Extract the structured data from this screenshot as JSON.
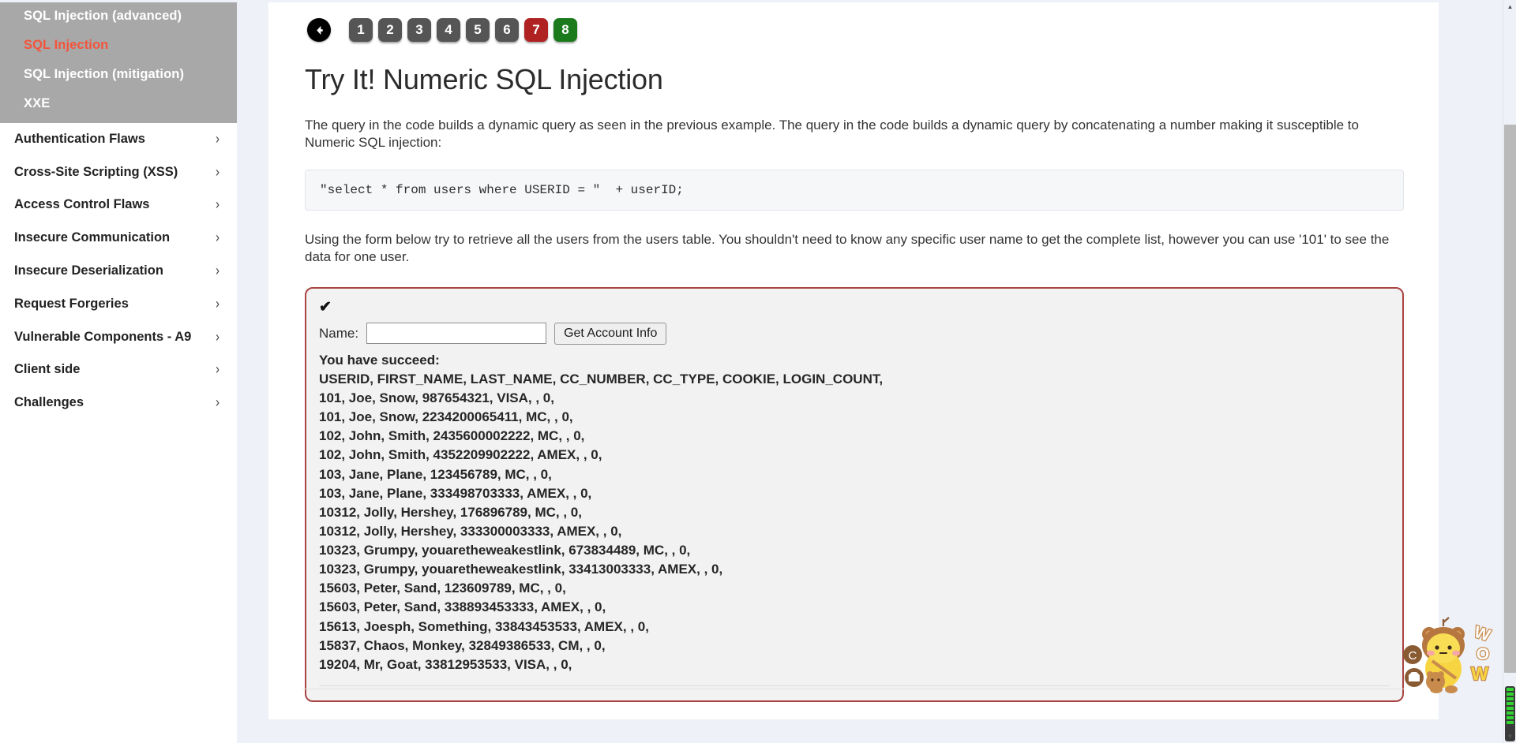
{
  "sidebar": {
    "subgroup": [
      {
        "label": "SQL Injection (advanced)",
        "active": false
      },
      {
        "label": "SQL Injection",
        "active": true
      },
      {
        "label": "SQL Injection (mitigation)",
        "active": false
      },
      {
        "label": "XXE",
        "active": false
      }
    ],
    "items": [
      {
        "label": "Authentication Flaws",
        "chevron": "›"
      },
      {
        "label": "Cross-Site Scripting (XSS)",
        "chevron": "›"
      },
      {
        "label": "Access Control Flaws",
        "chevron": "›"
      },
      {
        "label": "Insecure Communication",
        "chevron": "›"
      },
      {
        "label": "Insecure Deserialization",
        "chevron": "›"
      },
      {
        "label": "Request Forgeries",
        "chevron": "›"
      },
      {
        "label": "Vulnerable Components - A9",
        "chevron": "›"
      },
      {
        "label": "Client side",
        "chevron": "›"
      },
      {
        "label": "Challenges",
        "chevron": "›"
      }
    ]
  },
  "pager": {
    "back_icon": "←",
    "pages": [
      {
        "label": "1",
        "state": "normal"
      },
      {
        "label": "2",
        "state": "normal"
      },
      {
        "label": "3",
        "state": "normal"
      },
      {
        "label": "4",
        "state": "normal"
      },
      {
        "label": "5",
        "state": "normal"
      },
      {
        "label": "6",
        "state": "normal"
      },
      {
        "label": "7",
        "state": "current"
      },
      {
        "label": "8",
        "state": "done"
      }
    ],
    "colors": {
      "normal": "#555555",
      "current": "#b02121",
      "done": "#1b7a1b"
    }
  },
  "lesson": {
    "title": "Try It! Numeric SQL Injection",
    "intro": "The query in the code builds a dynamic query as seen in the previous example. The query in the code builds a dynamic query by concatenating a number making it susceptible to Numeric SQL injection:",
    "code": "\"select * from users where USERID = \"  + userID;",
    "instructions": "Using the form below try to retrieve all the users from the users table. You shouldn't need to know any specific user name to get the complete list, however you can use '101' to see the data for one user."
  },
  "form": {
    "status_icon": "✔",
    "name_label": "Name:",
    "name_value": "",
    "name_placeholder": "",
    "submit_label": "Get Account Info"
  },
  "result": {
    "status": "You have succeed:",
    "columns": "USERID, FIRST_NAME, LAST_NAME, CC_NUMBER, CC_TYPE, COOKIE, LOGIN_COUNT,",
    "rows": [
      "101, Joe, Snow, 987654321, VISA, , 0,",
      "101, Joe, Snow, 2234200065411, MC, , 0,",
      "102, John, Smith, 2435600002222, MC, , 0,",
      "102, John, Smith, 4352209902222, AMEX, , 0,",
      "103, Jane, Plane, 123456789, MC, , 0,",
      "103, Jane, Plane, 333498703333, AMEX, , 0,",
      "10312, Jolly, Hershey, 176896789, MC, , 0,",
      "10312, Jolly, Hershey, 333300003333, AMEX, , 0,",
      "10323, Grumpy, youaretheweakestlink, 673834489, MC, , 0,",
      "10323, Grumpy, youaretheweakestlink, 33413003333, AMEX, , 0,",
      "15603, Peter, Sand, 123609789, MC, , 0,",
      "15603, Peter, Sand, 338893453333, AMEX, , 0,",
      "15613, Joesph, Something, 33843453533, AMEX, , 0,",
      "15837, Chaos, Monkey, 32849386533, CM, , 0,",
      "19204, Mr, Goat, 33812953533, VISA, , 0,"
    ]
  },
  "scrollbar": {
    "up_arrow": "▲",
    "down_arrow": "▼"
  },
  "theme": {
    "panel_border": "#a94442",
    "sidebar_subgroup_bg": "#a8a8a8",
    "active_link": "#f4543c",
    "page_bg": "#eef1f7"
  }
}
